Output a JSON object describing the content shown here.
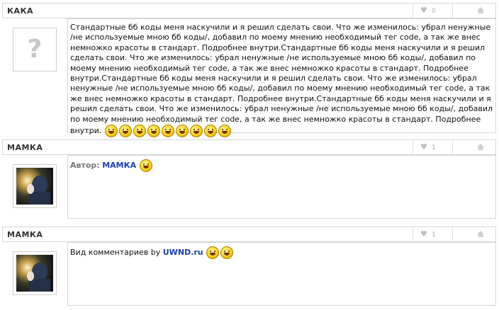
{
  "posts": [
    {
      "author": "КАКА",
      "likes": "0",
      "text": "Стандартные бб коды меня наскучили и я решил сделать свои. Что же изменилось: убрал ненужные /не используемые мною бб коды/, добавил по моему мнению необходимый тег code, а так же внес немножко красоты в стандарт. Подробнее внутри.Стандартные бб коды меня наскучили и я решил сделать свои. Что же изменилось: убрал ненужные /не используемые мною бб коды/, добавил по моему мнению необходимый тег code, а так же внес немножко красоты в стандарт. Подробнее внутри.Стандартные бб коды меня наскучили и я решил сделать свои. Что же изменилось: убрал ненужные /не используемые мною бб коды/, добавил по моему мнению необходимый тег code, а так же внес немножко красоты в стандарт. Подробнее внутри.Стандартные бб коды меня наскучили и я решил сделать свои. Что же изменилось: убрал ненужные /не используемые мною бб коды/, добавил по моему мнению необходимый тег code, а так же внес немножко красоты в стандарт. Подробнее внутри.",
      "emoticons": [
        "surprised-smiley-icon",
        "smile-smiley-icon",
        "smile-smiley-icon",
        "smile-smiley-icon",
        "smile-smiley-icon",
        "smile-smiley-icon",
        "smile-smiley-icon",
        "smile-smiley-icon",
        "smile-smiley-icon"
      ]
    },
    {
      "author": "МАМКА",
      "likes": "1",
      "label": "Автор:",
      "link": "МАМКА",
      "emoticons": [
        "smile-smiley-icon"
      ]
    },
    {
      "author": "МАМКА",
      "likes": "1",
      "text": "Вид комментариев by",
      "link": "UWND.ru",
      "emoticons": [
        "grin-smiley-icon",
        "smile-smiley-icon"
      ]
    }
  ],
  "colors": {
    "link": "#1a3fb0",
    "border": "#d6d6d6",
    "label": "#777777"
  }
}
